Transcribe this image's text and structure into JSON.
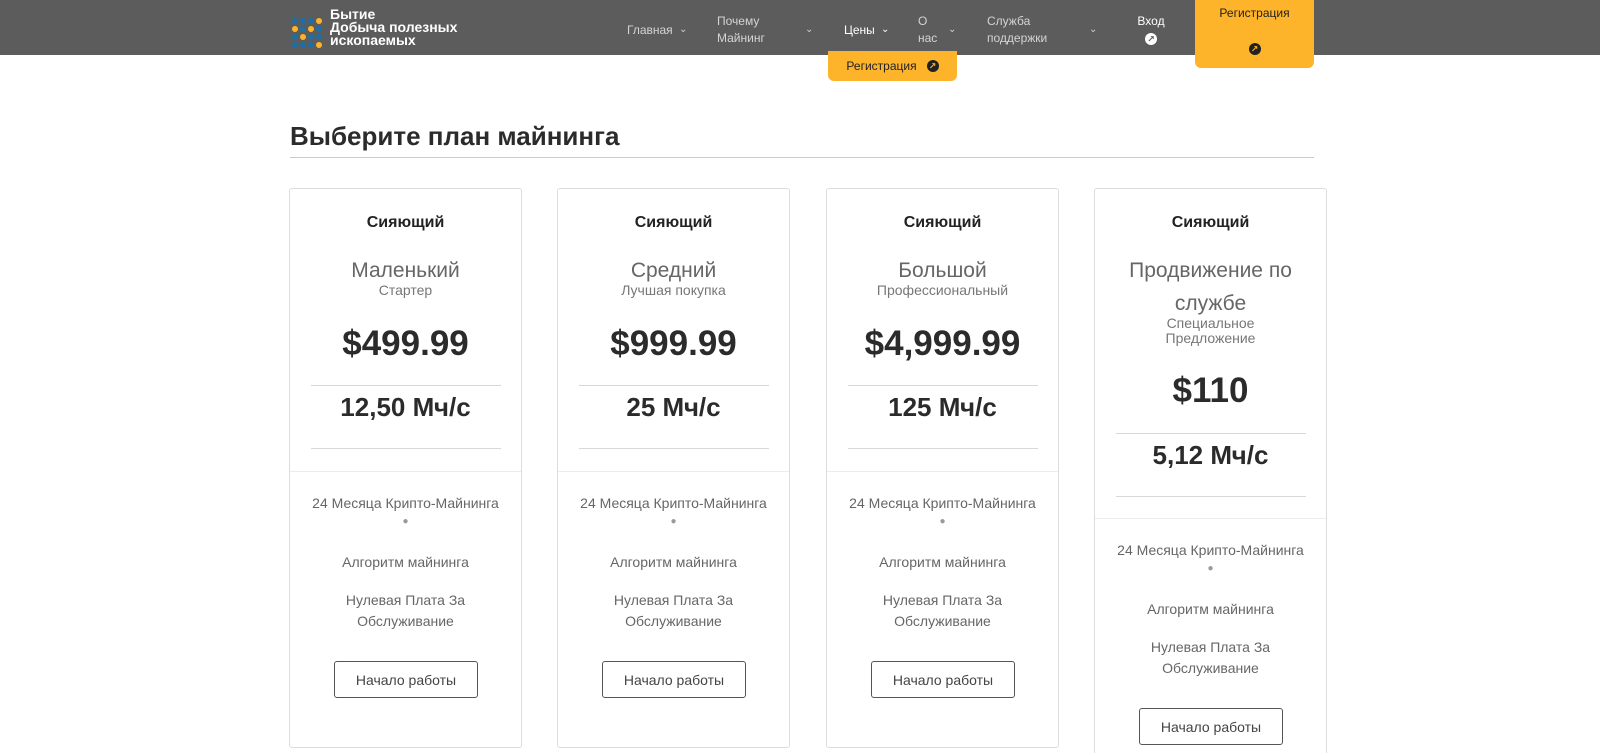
{
  "header": {
    "logo": {
      "line1": "Бытие",
      "line2": "Добыча полезных",
      "line3": "ископаемых"
    },
    "nav": [
      {
        "label": "Главная"
      },
      {
        "label": "Почему",
        "label2": "Майнинг"
      },
      {
        "label": "Цены"
      },
      {
        "label": "О",
        "label2": "нас"
      },
      {
        "label": "Служба",
        "label2": "поддержки"
      }
    ],
    "login_label": "Вход",
    "register_label": "Регистрация",
    "dropdown_register_label": "Регистрация"
  },
  "section_title": "Выберите план майнинга",
  "plans": [
    {
      "brand": "Сияющий",
      "name": "Маленький",
      "subtitle": "Стартер",
      "price": "$499.99",
      "hashrate": "12,50 Мч/с",
      "features": [
        "24 Месяца Крипто-Майнинга",
        "Алгоритм майнинга",
        "Нулевая Плата За",
        "Обслуживание"
      ],
      "button": "Начало работы"
    },
    {
      "brand": "Сияющий",
      "name": "Средний",
      "subtitle": "Лучшая покупка",
      "price": "$999.99",
      "hashrate": "25 Мч/с",
      "features": [
        "24 Месяца Крипто-Майнинга",
        "Алгоритм майнинга",
        "Нулевая Плата За",
        "Обслуживание"
      ],
      "button": "Начало работы"
    },
    {
      "brand": "Сияющий",
      "name": "Большой",
      "subtitle": "Профессиональный",
      "price": "$4,999.99",
      "hashrate": "125 Мч/с",
      "features": [
        "24 Месяца Крипто-Майнинга",
        "Алгоритм майнинга",
        "Нулевая Плата За",
        "Обслуживание"
      ],
      "button": "Начало работы"
    },
    {
      "brand": "Сияющий",
      "name_line1": "Продвижение по",
      "name_line2": "службе",
      "subtitle_line1": "Специальное",
      "subtitle_line2": "Предложение",
      "price": "$110",
      "hashrate": "5,12 Мч/с",
      "features": [
        "24 Месяца Крипто-Майнинга",
        "Алгоритм майнинга",
        "Нулевая Плата За",
        "Обслуживание"
      ],
      "button": "Начало работы"
    }
  ],
  "colors": {
    "header_bg": "#5c5c5c",
    "accent": "#fdb42b"
  }
}
